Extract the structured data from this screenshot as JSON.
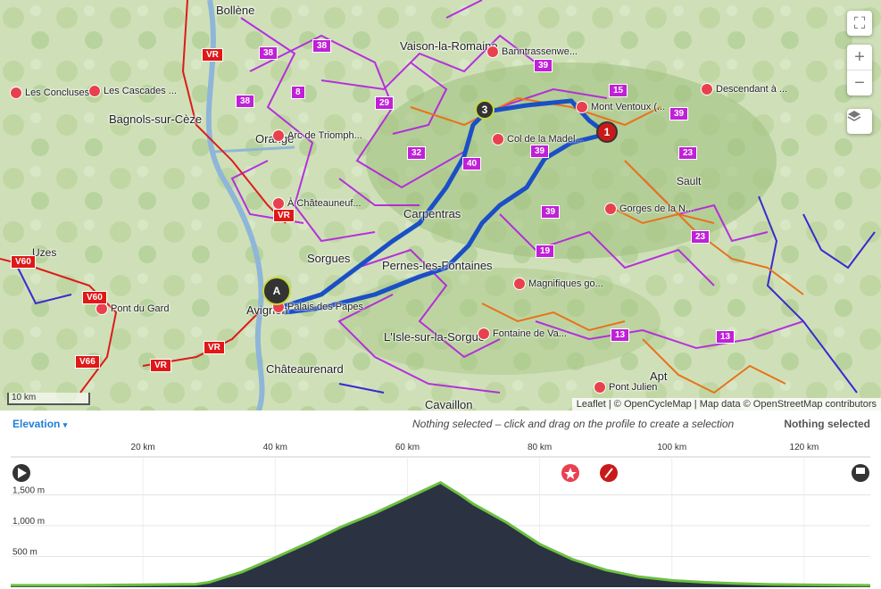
{
  "map": {
    "towns": [
      {
        "name": "Bollène"
      },
      {
        "name": "Vaison-la-Romaine"
      },
      {
        "name": "Bagnols-sur-Cèze"
      },
      {
        "name": "Orange"
      },
      {
        "name": "Carpentras"
      },
      {
        "name": "Sorgues"
      },
      {
        "name": "Pernes-les-Fontaines"
      },
      {
        "name": "Avignon"
      },
      {
        "name": "L'Isle-sur-la-Sorgue"
      },
      {
        "name": "Châteaurenard"
      },
      {
        "name": "Uzes"
      },
      {
        "name": "Sault"
      },
      {
        "name": "Apt"
      },
      {
        "name": "Cavaillon"
      }
    ],
    "pois": [
      {
        "name": "Les Concluses..."
      },
      {
        "name": "Les Cascades ..."
      },
      {
        "name": "Banntrassenwe..."
      },
      {
        "name": "Mont Ventoux (..."
      },
      {
        "name": "Descendant à ..."
      },
      {
        "name": "Arc de Triomph..."
      },
      {
        "name": "Col de la Madel..."
      },
      {
        "name": "À Châteauneuf..."
      },
      {
        "name": "Gorges de la N..."
      },
      {
        "name": "Palais des Papes"
      },
      {
        "name": "Pont du Gard"
      },
      {
        "name": "Magnifiques go..."
      },
      {
        "name": "Fontaine de Va..."
      },
      {
        "name": "Pont Julien"
      }
    ],
    "badges": [
      "38",
      "38",
      "38",
      "8",
      "39",
      "15",
      "39",
      "29",
      "32",
      "40",
      "39",
      "23",
      "39",
      "23",
      "19",
      "13",
      "13",
      "VR",
      "VR",
      "VR",
      "VR",
      "V60",
      "V60",
      "V66"
    ],
    "markers": [
      {
        "label": "A"
      },
      {
        "label": "1"
      },
      {
        "label": "3"
      }
    ],
    "controls": {
      "zoom_in": "+",
      "zoom_out": "−",
      "layers": "layers"
    },
    "scale": "10 km",
    "attribution": "Leaflet | © OpenCycleMap | Map data © OpenStreetMap contributors",
    "colors": {
      "route": "#1a4fc6",
      "cycle_purple": "#b21ee0",
      "cycle_orange": "#e8721a",
      "cycle_red": "#dd1b1b",
      "poi": "#e8404f"
    }
  },
  "elevation": {
    "title": "Elevation",
    "hint": "Nothing selected – click and drag on the profile to create a selection",
    "selection": "Nothing selected",
    "chart_data": {
      "type": "area",
      "x_ticks": [
        "20 km",
        "40 km",
        "60 km",
        "80 km",
        "100 km",
        "120 km"
      ],
      "y_ticks": [
        "1,500 m",
        "1,000 m",
        "500 m"
      ],
      "x_unit": "km",
      "y_unit": "m",
      "xlim": [
        0,
        130
      ],
      "ylim": [
        0,
        2000
      ],
      "x": [
        0,
        5,
        10,
        15,
        20,
        25,
        28,
        30,
        35,
        40,
        45,
        50,
        55,
        60,
        63,
        65,
        68,
        70,
        75,
        80,
        85,
        90,
        95,
        100,
        105,
        110,
        115,
        120,
        125,
        130
      ],
      "y": [
        30,
        30,
        30,
        35,
        40,
        45,
        50,
        80,
        250,
        480,
        720,
        980,
        1200,
        1450,
        1600,
        1700,
        1500,
        1350,
        1050,
        700,
        450,
        280,
        170,
        110,
        80,
        60,
        45,
        40,
        35,
        30
      ]
    }
  }
}
